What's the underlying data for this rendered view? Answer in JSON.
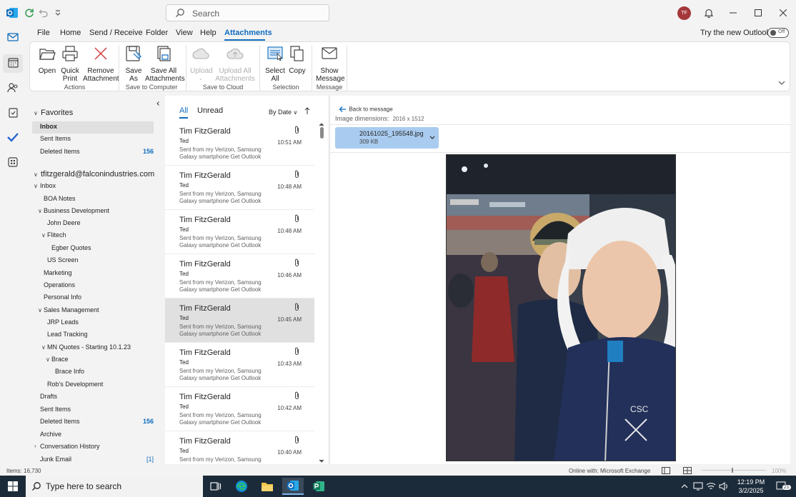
{
  "titlebar": {
    "search_placeholder": "Search",
    "avatar_initials": "TF"
  },
  "menu": {
    "tabs": [
      "File",
      "Home",
      "Send / Receive",
      "Folder",
      "View",
      "Help",
      "Attachments"
    ],
    "active_tab": "Attachments",
    "try_new_outlook": "Try the new Outlook",
    "toggle_state": "Off"
  },
  "ribbon": {
    "buttons": {
      "open": "Open",
      "quick_print_1": "Quick",
      "quick_print_2": "Print",
      "remove_1": "Remove",
      "remove_2": "Attachment",
      "save_as_1": "Save",
      "save_as_2": "As",
      "save_all_1": "Save All",
      "save_all_2": "Attachments",
      "upload": "Upload",
      "upload_all_1": "Upload All",
      "upload_all_2": "Attachments",
      "select_all_1": "Select",
      "select_all_2": "All",
      "copy": "Copy",
      "show_message_1": "Show",
      "show_message_2": "Message"
    },
    "groups": {
      "actions": "Actions",
      "save_to_computer": "Save to Computer",
      "save_to_cloud": "Save to Cloud",
      "selection": "Selection",
      "message": "Message"
    }
  },
  "folders": {
    "favorites_header": "Favorites",
    "favorites": [
      {
        "name": "Inbox",
        "count": ""
      },
      {
        "name": "Sent Items",
        "count": ""
      },
      {
        "name": "Deleted Items",
        "count": "156"
      }
    ],
    "account": "tfitzgerald@falconindustries.com",
    "tree": [
      {
        "name": "Inbox",
        "count": ""
      },
      {
        "name": "BOA Notes",
        "count": ""
      },
      {
        "name": "Business Development",
        "count": ""
      },
      {
        "name": "John Deere",
        "count": ""
      },
      {
        "name": "Flitech",
        "count": ""
      },
      {
        "name": "Egber Quotes",
        "count": ""
      },
      {
        "name": "US Screen",
        "count": ""
      },
      {
        "name": "Marketing",
        "count": ""
      },
      {
        "name": "Operations",
        "count": ""
      },
      {
        "name": "Personal Info",
        "count": ""
      },
      {
        "name": "Sales Management",
        "count": ""
      },
      {
        "name": "JRP Leads",
        "count": ""
      },
      {
        "name": "Lead Tracking",
        "count": ""
      },
      {
        "name": "MN Quotes - Starting 10.1.23",
        "count": ""
      },
      {
        "name": "Brace",
        "count": ""
      },
      {
        "name": "Brace Info",
        "count": ""
      },
      {
        "name": "Rob's Development",
        "count": ""
      },
      {
        "name": "Drafts",
        "count": ""
      },
      {
        "name": "Sent Items",
        "count": ""
      },
      {
        "name": "Deleted Items",
        "count": "156"
      },
      {
        "name": "Archive",
        "count": ""
      },
      {
        "name": "Conversation History",
        "count": ""
      },
      {
        "name": "Junk Email",
        "count": "[1]"
      }
    ]
  },
  "msglist": {
    "filter_all": "All",
    "filter_unread": "Unread",
    "sort": "By Date",
    "messages": [
      {
        "sender": "Tim FitzGerald",
        "subject": "Ted",
        "preview": "Sent from my Verizon, Samsung Galaxy smartphone Get Outlook",
        "time": "10:51 AM"
      },
      {
        "sender": "Tim FitzGerald",
        "subject": "Ted",
        "preview": "Sent from my Verizon, Samsung Galaxy smartphone Get Outlook",
        "time": "10:48 AM"
      },
      {
        "sender": "Tim FitzGerald",
        "subject": "Ted",
        "preview": "Sent from my Verizon, Samsung Galaxy smartphone Get Outlook",
        "time": "10:48 AM"
      },
      {
        "sender": "Tim FitzGerald",
        "subject": "Ted",
        "preview": "Sent from my Verizon, Samsung Galaxy smartphone Get Outlook",
        "time": "10:46 AM"
      },
      {
        "sender": "Tim FitzGerald",
        "subject": "Ted",
        "preview": "Sent from my Verizon, Samsung Galaxy smartphone Get Outlook",
        "time": "10:45 AM"
      },
      {
        "sender": "Tim FitzGerald",
        "subject": "Ted",
        "preview": "Sent from my Verizon, Samsung Galaxy smartphone Get Outlook",
        "time": "10:43 AM"
      },
      {
        "sender": "Tim FitzGerald",
        "subject": "Ted",
        "preview": "Sent from my Verizon, Samsung Galaxy smartphone Get Outlook",
        "time": "10:42 AM"
      },
      {
        "sender": "Tim FitzGerald",
        "subject": "Ted",
        "preview": "Sent from my Verizon, Samsung Galaxy smartphone Get Outlook",
        "time": "10:40 AM"
      }
    ],
    "selected_index": 4
  },
  "reading": {
    "back": "Back to message",
    "image_dims_label": "Image dimensions:",
    "image_dims_value": "2016 x 1512",
    "attachment_name": "20161025_195548.jpg",
    "attachment_size": "309 KB"
  },
  "status": {
    "items": "Items: 16,730",
    "connection": "Online with: Microsoft Exchange",
    "zoom": "100%"
  },
  "taskbar": {
    "search_placeholder": "Type here to search",
    "time": "12:19 PM",
    "date": "3/2/2025",
    "notifications": "21"
  },
  "colors": {
    "accent": "#0f6cbd",
    "avatar": "#a4373a",
    "attachment_chip": "#a9cbef",
    "taskbar": "#1c2b3a"
  }
}
